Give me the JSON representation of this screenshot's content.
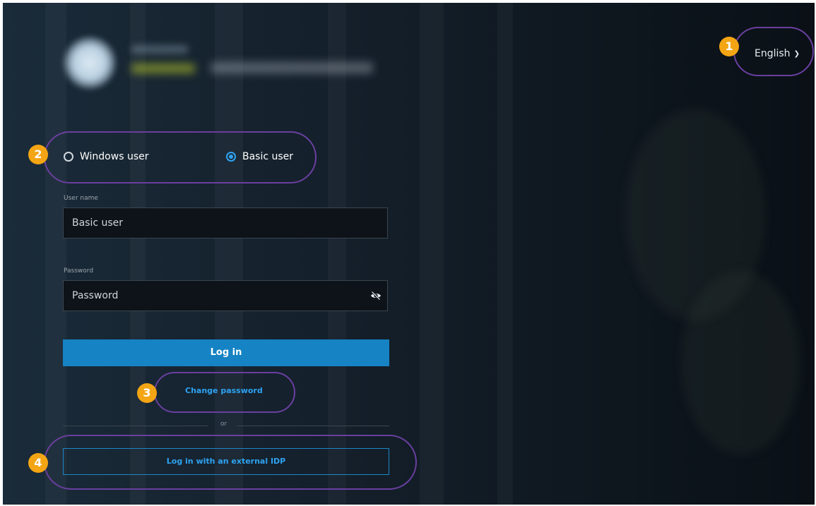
{
  "header": {
    "language_label": "English",
    "language_icon": "chevron-down-icon"
  },
  "callouts": [
    "1",
    "2",
    "3",
    "4"
  ],
  "login_type": {
    "options": [
      {
        "label": "Windows user",
        "selected": false
      },
      {
        "label": "Basic user",
        "selected": true
      }
    ]
  },
  "form": {
    "username_label": "User name",
    "username_value": "Basic user",
    "password_label": "Password",
    "password_placeholder": "Password",
    "password_toggle_icon": "eye-slash-icon"
  },
  "actions": {
    "login_label": "Log in",
    "change_password_label": "Change password",
    "or_label": "or",
    "external_idp_label": "Log in with an external IDP"
  },
  "colors": {
    "accent": "#1583c4",
    "link": "#2ea3f2",
    "callout_badge": "#f4a514",
    "callout_ring": "#6a3fa0"
  }
}
